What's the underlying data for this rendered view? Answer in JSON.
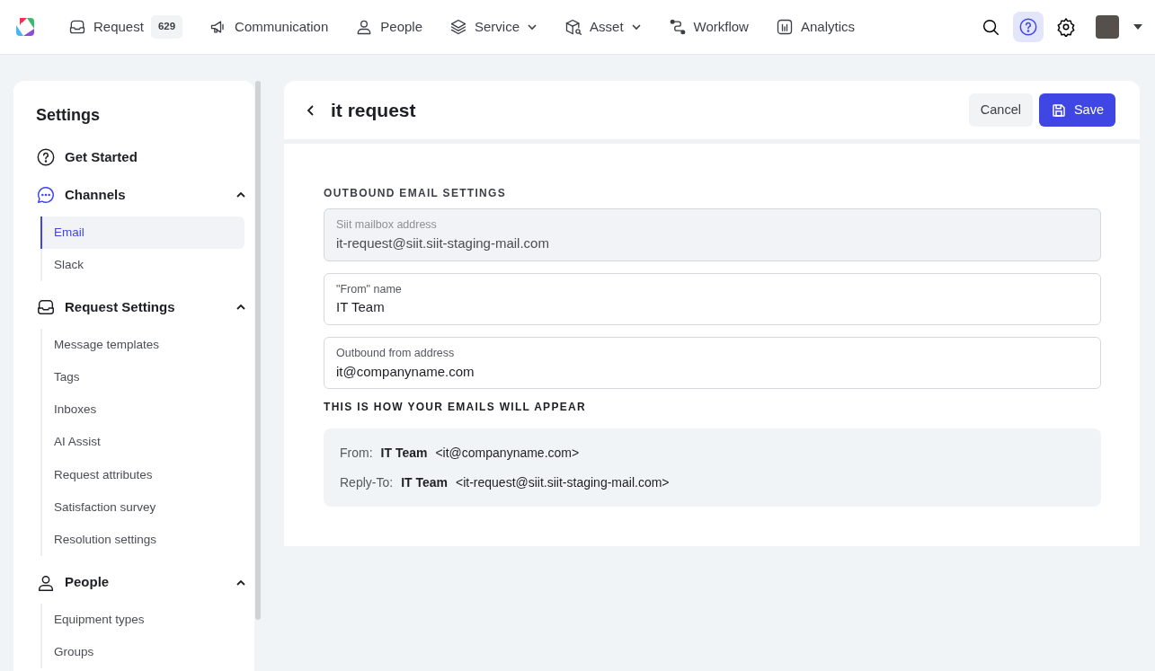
{
  "navbar": {
    "items": [
      {
        "label": "Request",
        "kind": "inbox",
        "badge": "629",
        "dropdown": false
      },
      {
        "label": "Communication",
        "kind": "megaphone",
        "dropdown": false
      },
      {
        "label": "People",
        "kind": "person",
        "dropdown": false
      },
      {
        "label": "Service",
        "kind": "layers",
        "dropdown": true
      },
      {
        "label": "Asset",
        "kind": "box",
        "dropdown": true
      },
      {
        "label": "Workflow",
        "kind": "flow",
        "dropdown": false
      },
      {
        "label": "Analytics",
        "kind": "chart",
        "dropdown": false
      }
    ],
    "actions": [
      {
        "kind": "search",
        "selected": false
      },
      {
        "kind": "help",
        "selected": true
      },
      {
        "kind": "settings",
        "selected": false
      }
    ]
  },
  "sidebar": {
    "title": "Settings",
    "groups": [
      {
        "label": "Get Started",
        "kind": "help",
        "selected": false
      },
      {
        "label": "Channels",
        "kind": "chat",
        "selected": true,
        "expanded": true,
        "items": [
          {
            "label": "Email",
            "selected": true
          },
          {
            "label": "Slack",
            "selected": false
          }
        ]
      },
      {
        "label": "Request Settings",
        "kind": "inbox",
        "selected": false,
        "expanded": true,
        "items": [
          {
            "label": "Message templates",
            "selected": false
          },
          {
            "label": "Tags",
            "selected": false
          },
          {
            "label": "Inboxes",
            "selected": false
          },
          {
            "label": "AI Assist",
            "selected": false
          },
          {
            "label": "Request attributes",
            "selected": false
          },
          {
            "label": "Satisfaction survey",
            "selected": false
          },
          {
            "label": "Resolution settings",
            "selected": false
          }
        ]
      },
      {
        "label": "People",
        "kind": "person",
        "selected": false,
        "expanded": true,
        "items": [
          {
            "label": "Equipment types",
            "selected": false
          },
          {
            "label": "Groups",
            "selected": false
          }
        ]
      }
    ]
  },
  "header": {
    "title": "it request",
    "cancel": "Cancel",
    "save": "Save"
  },
  "form": {
    "section_title": "OUTBOUND EMAIL SETTINGS",
    "fields": [
      {
        "label": "Siit mailbox address",
        "value": "it-request@siit.siit-staging-mail.com",
        "disabled": true
      },
      {
        "label": "\"From\" name",
        "value": "IT Team",
        "disabled": false
      },
      {
        "label": "Outbound from address",
        "value": "it@companyname.com",
        "disabled": false
      }
    ],
    "preview_title": "THIS IS HOW YOUR EMAILS WILL APPEAR",
    "preview": [
      {
        "label": "From:",
        "name": "IT Team",
        "address": "<it@companyname.com>"
      },
      {
        "label": "Reply-To:",
        "name": "IT Team",
        "address": "<it-request@siit.siit-staging-mail.com>"
      }
    ]
  }
}
